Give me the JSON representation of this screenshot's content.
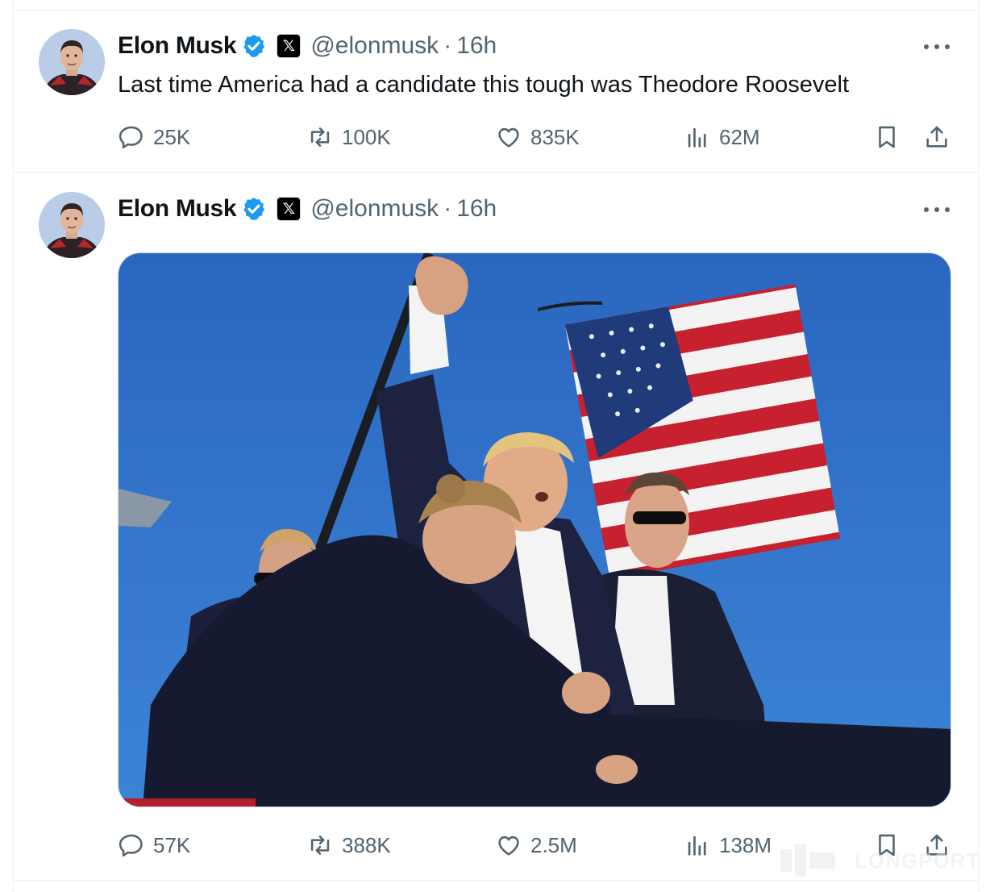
{
  "tweets": [
    {
      "author": "Elon Musk",
      "handle": "@elonmusk",
      "separator": "·",
      "time": "16h",
      "text": "Last time America had a candidate this tough was Theodore Roosevelt",
      "replies": "25K",
      "reposts": "100K",
      "likes": "835K",
      "views": "62M"
    },
    {
      "author": "Elon Musk",
      "handle": "@elonmusk",
      "separator": "·",
      "time": "16h",
      "text": "",
      "replies": "57K",
      "reposts": "388K",
      "likes": "2.5M",
      "views": "138M"
    }
  ],
  "watermark": {
    "text": "LONGPORT"
  },
  "colors": {
    "accent": "#1d9bf0",
    "muted": "#536471",
    "border": "#e6ecf0",
    "sky": "#2b6fc6"
  },
  "icons": [
    "verified-badge-icon",
    "x-logo-icon",
    "more-icon",
    "reply-icon",
    "repost-icon",
    "like-icon",
    "views-icon",
    "bookmark-icon",
    "share-icon"
  ]
}
